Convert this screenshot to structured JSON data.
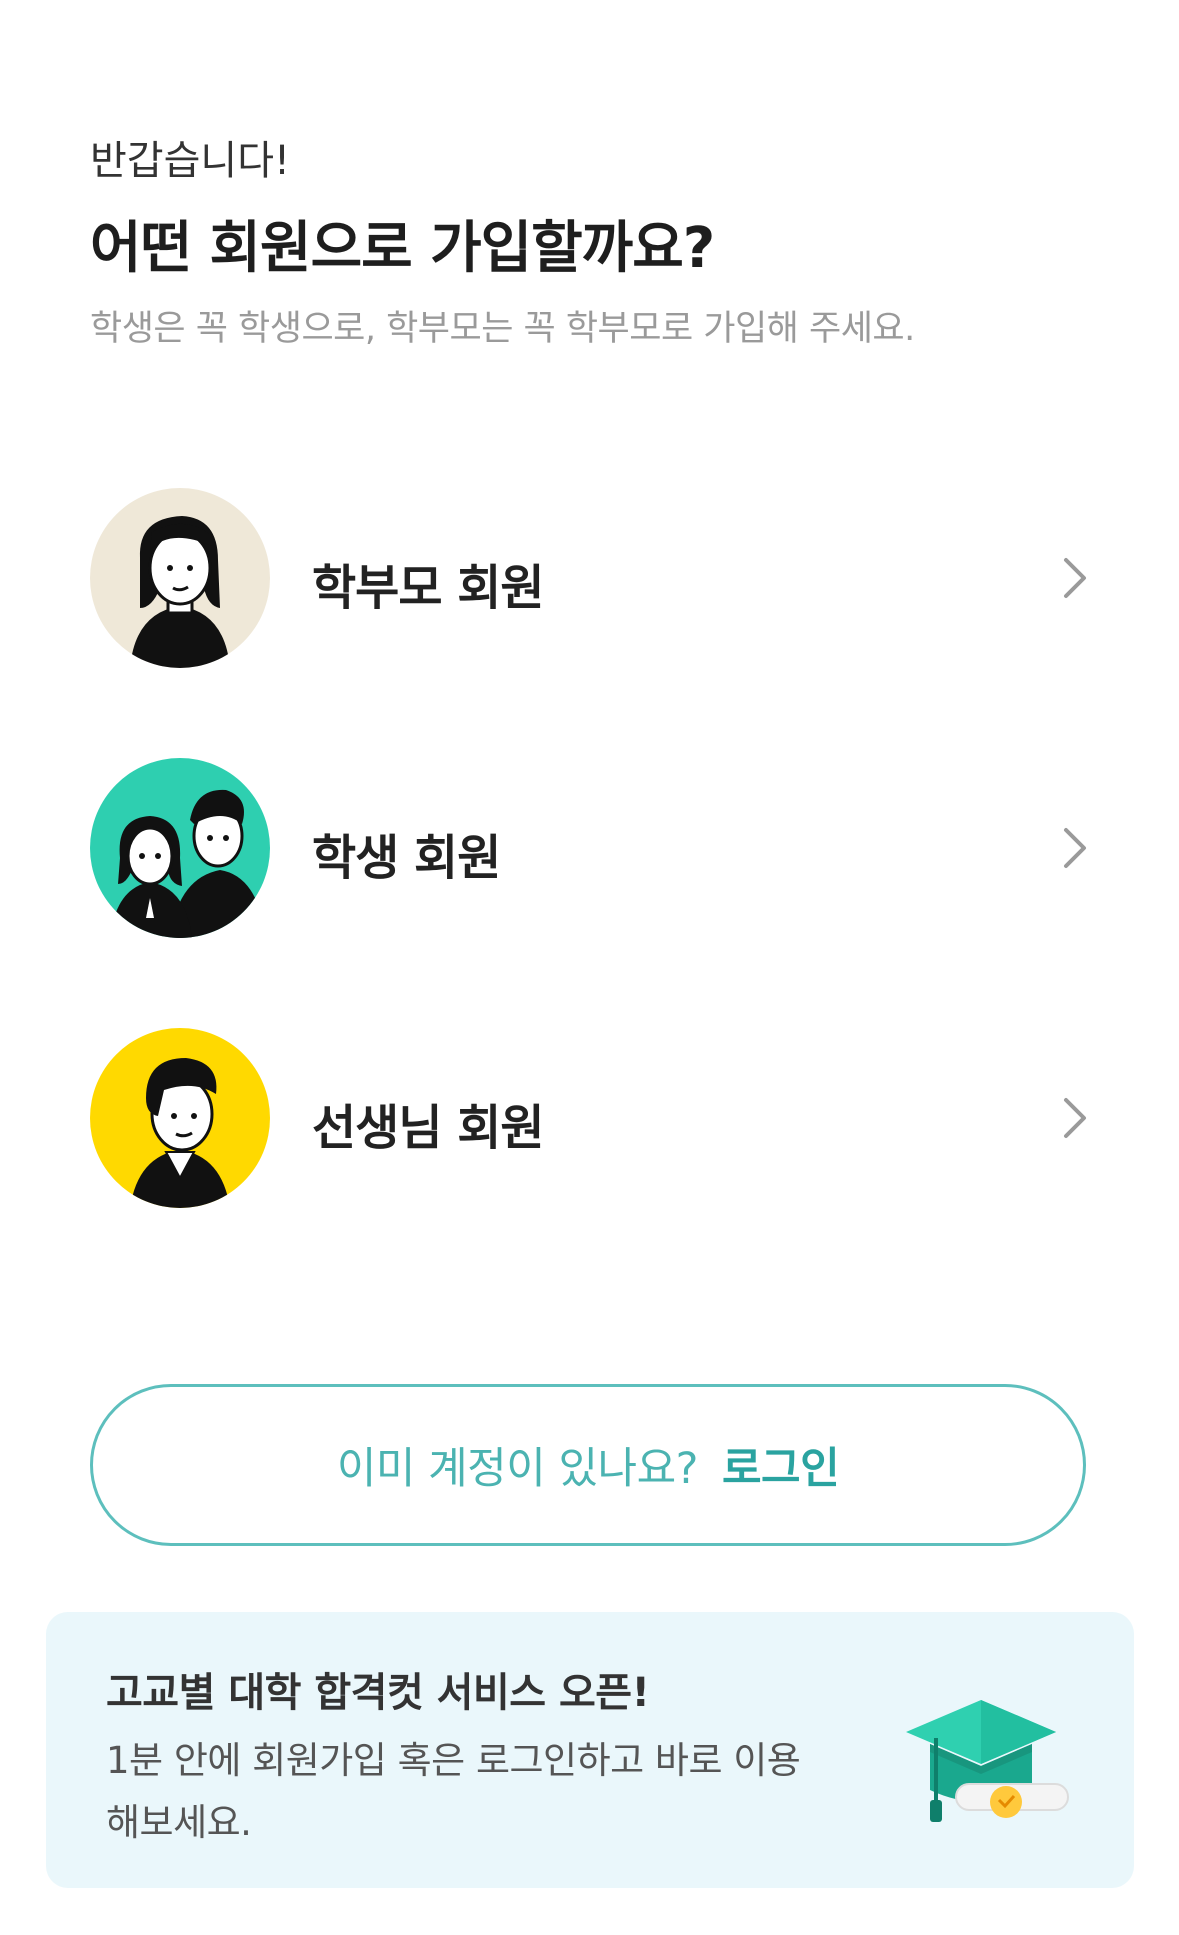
{
  "header": {
    "greeting": "반갑습니다!",
    "title": "어떤 회원으로 가입할까요?",
    "subtitle": "학생은 꼭 학생으로, 학부모는 꼭 학부모로 가입해 주세요."
  },
  "options": [
    {
      "label": "학부모 회원",
      "avatar_bg": "#efe8d8",
      "icon": "parent-avatar-icon"
    },
    {
      "label": "학생 회원",
      "avatar_bg": "#2ecfb0",
      "icon": "students-avatar-icon"
    },
    {
      "label": "선생님 회원",
      "avatar_bg": "#ffd900",
      "icon": "teacher-avatar-icon"
    }
  ],
  "login": {
    "prompt": "이미 계정이 있나요?",
    "action": "로그인"
  },
  "banner": {
    "title": "고교별 대학 합격컷 서비스 오픈!",
    "description": "1분 안에 회원가입 혹은 로그인하고 바로 이용해보세요.",
    "icon": "graduation-cap-icon",
    "background": "#eaf7fb"
  },
  "colors": {
    "accent": "#4bb3b1",
    "accent_strong": "#2aa3a0"
  }
}
